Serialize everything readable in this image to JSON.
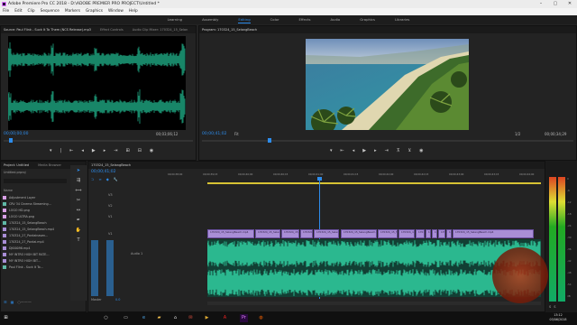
{
  "window": {
    "title": "Adobe Premiere Pro CC 2018 - D:\\ADOBE PREMIER PRO PROJECT\\Untitled *"
  },
  "menu": [
    "File",
    "Edit",
    "Clip",
    "Sequence",
    "Markers",
    "Graphics",
    "Window",
    "Help"
  ],
  "workspaces": {
    "items": [
      "Learning",
      "Assembly",
      "Editing",
      "Color",
      "Effects",
      "Audio",
      "Graphics",
      "Libraries"
    ],
    "active_index": 2
  },
  "source": {
    "tabs": [
      "Source: Paul Flink - Suck It To Them (NCS Release).mp3",
      "Effect Controls",
      "Audio Clip Mixer: 170324_15_Selan"
    ],
    "timecode_left": "00;00;00;00",
    "timecode_right": "00;03;06;12"
  },
  "program": {
    "tab": "Program: 170324_15_SelangBeach",
    "timecode_left": "00;00;41;02",
    "fit": "Fit",
    "zoom": "1/2",
    "timecode_right": "00;00;34;29"
  },
  "project": {
    "tabs": [
      "Project: Untitled",
      "Media Browser"
    ],
    "file": "Untitled.prproj",
    "column": "Name",
    "items": [
      {
        "name": "Adjustment Layer",
        "color": "#d8a0e6"
      },
      {
        "name": "CRV 34 Cinema Streaming...",
        "color": "#5fb9a6"
      },
      {
        "name": "LOGO HD.png",
        "color": "#d8a0e6"
      },
      {
        "name": "LOGO ULTRA.png",
        "color": "#d8a0e6"
      },
      {
        "name": "170324_15_SelangBeach",
        "color": "#5fb9a6"
      },
      {
        "name": "170324_15_SelangBeach.mp4",
        "color": "#a98ed6"
      },
      {
        "name": "170324_27_Pantainasen...",
        "color": "#a98ed6"
      },
      {
        "name": "170324_27_Pantai.mp4",
        "color": "#a98ed6"
      },
      {
        "name": "DJI00098.mp4",
        "color": "#a98ed6"
      },
      {
        "name": "MY INTRO HIGH BIT RATE...",
        "color": "#a98ed6"
      },
      {
        "name": "MY INTRO HIGH BIT...",
        "color": "#a98ed6"
      },
      {
        "name": "Paul Flink - Suck It To...",
        "color": "#5fb9a6"
      }
    ]
  },
  "timeline": {
    "tab": "170324_15_SelangBeach",
    "timecode": "00;00;41;02",
    "ruler": [
      "00;00;38;00",
      "00;00;39;15",
      "00;00;40;00",
      "00;00;40;15",
      "00;00;41;00",
      "00;00;41;15",
      "00;00;42;00",
      "00;00;42;15",
      "00;00;43;00",
      "00;00;43;15",
      "00;00;44;00"
    ],
    "video_tracks": [
      "V3",
      "V2",
      "V1"
    ],
    "audio_tracks": [
      "A1",
      "A2",
      "A3"
    ],
    "audio_label": "Audio 1",
    "clip_name": "170324_15_SelangBeach.mp4",
    "master": "Master",
    "master_value": "0.0"
  },
  "meters": {
    "scale": [
      "0",
      "-6",
      "-12",
      "-18",
      "-24",
      "-30",
      "-36",
      "-42",
      "-48",
      "-54",
      "dB"
    ],
    "buttons": [
      "S",
      "S"
    ]
  },
  "taskbar": {
    "time": "13:12",
    "date": "03/06/2018"
  },
  "watermark": {
    "text": "KLEP CHABAR"
  },
  "colors": {
    "accent": "#2d8ceb",
    "audio_wave": "#1fa882",
    "video_clip": "#a98ed6",
    "in_out": "#d7c234"
  }
}
